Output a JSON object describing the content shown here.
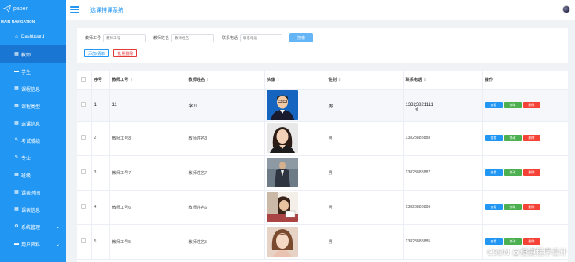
{
  "sidebar": {
    "logo_text": "paper",
    "nav_heading": "MAIN NAVIGATION",
    "items": [
      {
        "label": "Dashboard",
        "icon": "home-icon"
      },
      {
        "label": "教师",
        "icon": "grid-icon",
        "active": true
      },
      {
        "label": "学生",
        "icon": "user-icon"
      },
      {
        "label": "课程信息",
        "icon": "grid-icon"
      },
      {
        "label": "课程类型",
        "icon": "grid-icon"
      },
      {
        "label": "选课信息",
        "icon": "grid-icon"
      },
      {
        "label": "考试成绩",
        "icon": "pen-icon"
      },
      {
        "label": "专业",
        "icon": "pen-icon"
      },
      {
        "label": "班级",
        "icon": "grid-icon"
      },
      {
        "label": "课表时间",
        "icon": "grid-icon"
      },
      {
        "label": "课表信息",
        "icon": "grid-icon"
      },
      {
        "label": "系统管理",
        "icon": "gear-icon",
        "expandable": true
      },
      {
        "label": "用户资料",
        "icon": "user-icon",
        "expandable": true
      }
    ]
  },
  "header": {
    "title": "选课排课系统"
  },
  "search": {
    "teacher_no_label": "教师工号",
    "teacher_no_placeholder": "教师工号",
    "teacher_name_label": "教师姓名",
    "teacher_name_placeholder": "教师姓名",
    "phone_label": "联系电话",
    "phone_placeholder": "联系电话",
    "search_button": "搜索"
  },
  "actions": {
    "add": "添加/清单",
    "batch_delete": "批量删除"
  },
  "table": {
    "headers": [
      "序号",
      "教师工号",
      "教师姓名",
      "头像",
      "性别",
      "联系电话",
      "操作"
    ],
    "rows": [
      {
        "index": "1",
        "no": "11",
        "name": "李四",
        "gender": "男",
        "phone": "13823821111"
      },
      {
        "index": "2",
        "no": "教师工号8",
        "name": "教师姓名8",
        "gender": "男",
        "phone": "13823888888"
      },
      {
        "index": "3",
        "no": "教师工号7",
        "name": "教师姓名7",
        "gender": "男",
        "phone": "13823888887"
      },
      {
        "index": "4",
        "no": "教师工号6",
        "name": "教师姓名6",
        "gender": "男",
        "phone": "13823888886"
      },
      {
        "index": "5",
        "no": "教师工号5",
        "name": "教师姓名5",
        "gender": "男",
        "phone": "13823888885"
      }
    ],
    "op_view": "查看",
    "op_edit": "修改",
    "op_delete": "删除"
  },
  "watermark": "CSDN @便捷程序设计",
  "colors": {
    "primary": "#2196f3",
    "success": "#4caf50",
    "danger": "#f44336"
  }
}
